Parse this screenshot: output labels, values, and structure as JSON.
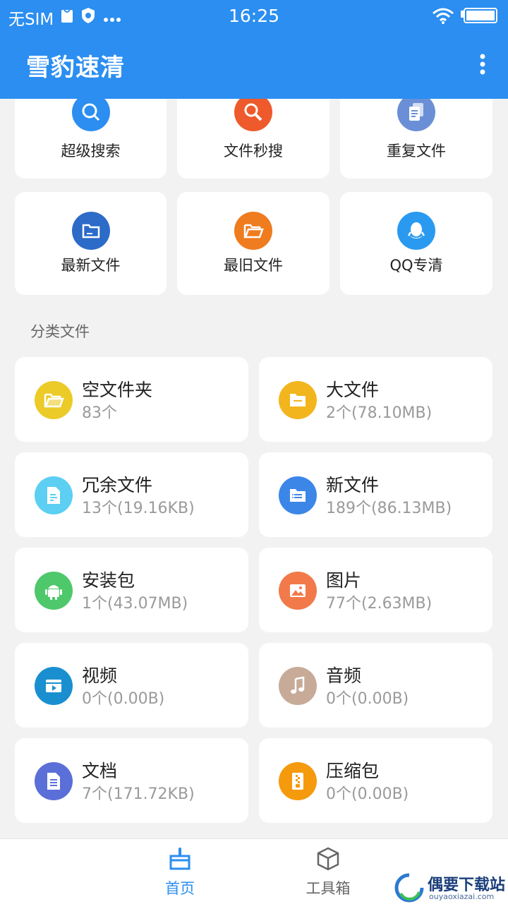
{
  "status": {
    "carrier": "无SIM",
    "time": "16:25"
  },
  "app": {
    "title": "雪豹速清"
  },
  "tools": [
    {
      "label": "超级搜索",
      "icon": "magnifier-icon",
      "color": "#2b8ef0"
    },
    {
      "label": "文件秒搜",
      "icon": "search-icon",
      "color": "#ee5a2b"
    },
    {
      "label": "重复文件",
      "icon": "copy-document-icon",
      "color": "#6a8fd6"
    },
    {
      "label": "最新文件",
      "icon": "folder-new-icon",
      "color": "#2d6bc9"
    },
    {
      "label": "最旧文件",
      "icon": "folder-open-icon",
      "color": "#ef7c1f"
    },
    {
      "label": "QQ专清",
      "icon": "qq-penguin-icon",
      "color": "#2a9af0"
    }
  ],
  "section": {
    "title": "分类文件"
  },
  "categories": [
    {
      "name": "空文件夹",
      "info": "83个",
      "icon": "folder-open-icon",
      "color": "#ecca27"
    },
    {
      "name": "大文件",
      "info": "2个(78.10MB)",
      "icon": "folder-icon",
      "color": "#f3b51d"
    },
    {
      "name": "冗余文件",
      "info": "13个(19.16KB)",
      "icon": "document-icon",
      "color": "#5ccff3"
    },
    {
      "name": "新文件",
      "info": "189个(86.13MB)",
      "icon": "folder-list-icon",
      "color": "#3c86e8"
    },
    {
      "name": "安装包",
      "info": "1个(43.07MB)",
      "icon": "android-icon",
      "color": "#4ec86b"
    },
    {
      "name": "图片",
      "info": "77个(2.63MB)",
      "icon": "image-icon",
      "color": "#f27a4a"
    },
    {
      "name": "视频",
      "info": "0个(0.00B)",
      "icon": "video-icon",
      "color": "#1a8fd0"
    },
    {
      "name": "音频",
      "info": "0个(0.00B)",
      "icon": "music-note-icon",
      "color": "#c7ab98"
    },
    {
      "name": "文档",
      "info": "7个(171.72KB)",
      "icon": "document-lines-icon",
      "color": "#5a6fd8"
    },
    {
      "name": "压缩包",
      "info": "0个(0.00B)",
      "icon": "zip-icon",
      "color": "#f59a0c"
    }
  ],
  "nav": {
    "home": {
      "label": "首页",
      "icon": "broom-icon",
      "active_color": "#2b8ef0"
    },
    "tools": {
      "label": "工具箱",
      "icon": "cube-icon",
      "color": "#666666"
    }
  },
  "watermark": {
    "text": "偶要下载站",
    "sub": "ouyaoxiazai.com"
  }
}
